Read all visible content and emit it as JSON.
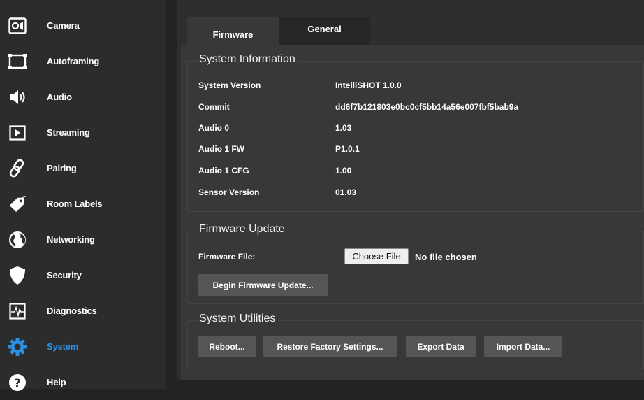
{
  "colors": {
    "accent": "#2e8fe0"
  },
  "sidebar": {
    "items": [
      {
        "label": "Camera",
        "icon": "camera-icon"
      },
      {
        "label": "Autoframing",
        "icon": "autoframing-icon"
      },
      {
        "label": "Audio",
        "icon": "speaker-icon"
      },
      {
        "label": "Streaming",
        "icon": "play-icon"
      },
      {
        "label": "Pairing",
        "icon": "link-icon"
      },
      {
        "label": "Room Labels",
        "icon": "tag-icon"
      },
      {
        "label": "Networking",
        "icon": "globe-icon"
      },
      {
        "label": "Security",
        "icon": "shield-icon"
      },
      {
        "label": "Diagnostics",
        "icon": "pulse-icon"
      },
      {
        "label": "System",
        "icon": "gear-icon",
        "active": true
      },
      {
        "label": "Help",
        "icon": "help-icon"
      }
    ]
  },
  "tabs": [
    {
      "label": "Firmware",
      "active": true
    },
    {
      "label": "General",
      "active": false
    }
  ],
  "system_info": {
    "title": "System Information",
    "rows": [
      {
        "label": "System Version",
        "value": "IntelliSHOT 1.0.0"
      },
      {
        "label": "Commit",
        "value": "dd6f7b121803e0bc0cf5bb14a56e007fbf5bab9a"
      },
      {
        "label": "Audio 0",
        "value": "1.03"
      },
      {
        "label": "Audio 1 FW",
        "value": "P1.0.1"
      },
      {
        "label": "Audio 1 CFG",
        "value": "1.00"
      },
      {
        "label": "Sensor Version",
        "value": "01.03"
      }
    ]
  },
  "firmware_update": {
    "title": "Firmware Update",
    "file_label": "Firmware File:",
    "choose_label": "Choose File",
    "no_file_text": "No file chosen",
    "begin_label": "Begin Firmware Update..."
  },
  "system_utilities": {
    "title": "System Utilities",
    "buttons": [
      "Reboot...",
      "Restore Factory Settings...",
      "Export Data",
      "Import Data..."
    ]
  }
}
